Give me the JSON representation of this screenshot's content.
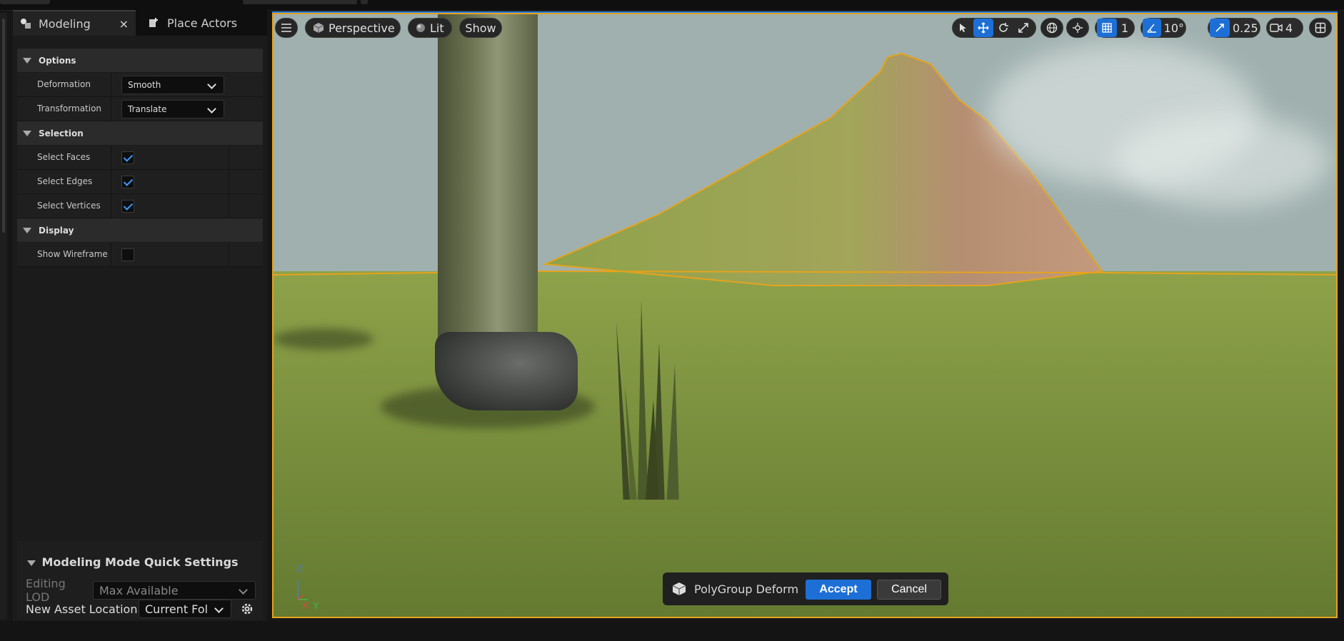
{
  "tabs": {
    "modeling": "Modeling",
    "place_actors": "Place Actors",
    "close_glyph": "×"
  },
  "options": {
    "title": "Options",
    "deformation_label": "Deformation",
    "deformation_value": "Smooth",
    "transformation_label": "Transformation",
    "transformation_value": "Translate"
  },
  "selection": {
    "title": "Selection",
    "faces_label": "Select Faces",
    "faces_checked": true,
    "edges_label": "Select Edges",
    "edges_checked": true,
    "vertices_label": "Select Vertices",
    "vertices_checked": true
  },
  "display": {
    "title": "Display",
    "wireframe_label": "Show Wireframe",
    "wireframe_checked": false
  },
  "quick_settings": {
    "title": "Modeling Mode Quick Settings",
    "lod_label": "Editing LOD",
    "lod_value": "Max Available",
    "asset_label": "New Asset Location",
    "asset_value": "Current Fol"
  },
  "viewport": {
    "perspective": "Perspective",
    "lit": "Lit",
    "show": "Show",
    "grid_value": "1",
    "angle_value": "10°",
    "scale_value": "0.25",
    "camera_value": "4",
    "axis_z": "Z",
    "axis_x": "X",
    "axis_y": "Y"
  },
  "tool_bar": {
    "tool_name": "PolyGroup Deform",
    "accept": "Accept",
    "cancel": "Cancel"
  },
  "colors": {
    "accent": "#1d6fd6",
    "selection_outline": "#e5a31d"
  }
}
